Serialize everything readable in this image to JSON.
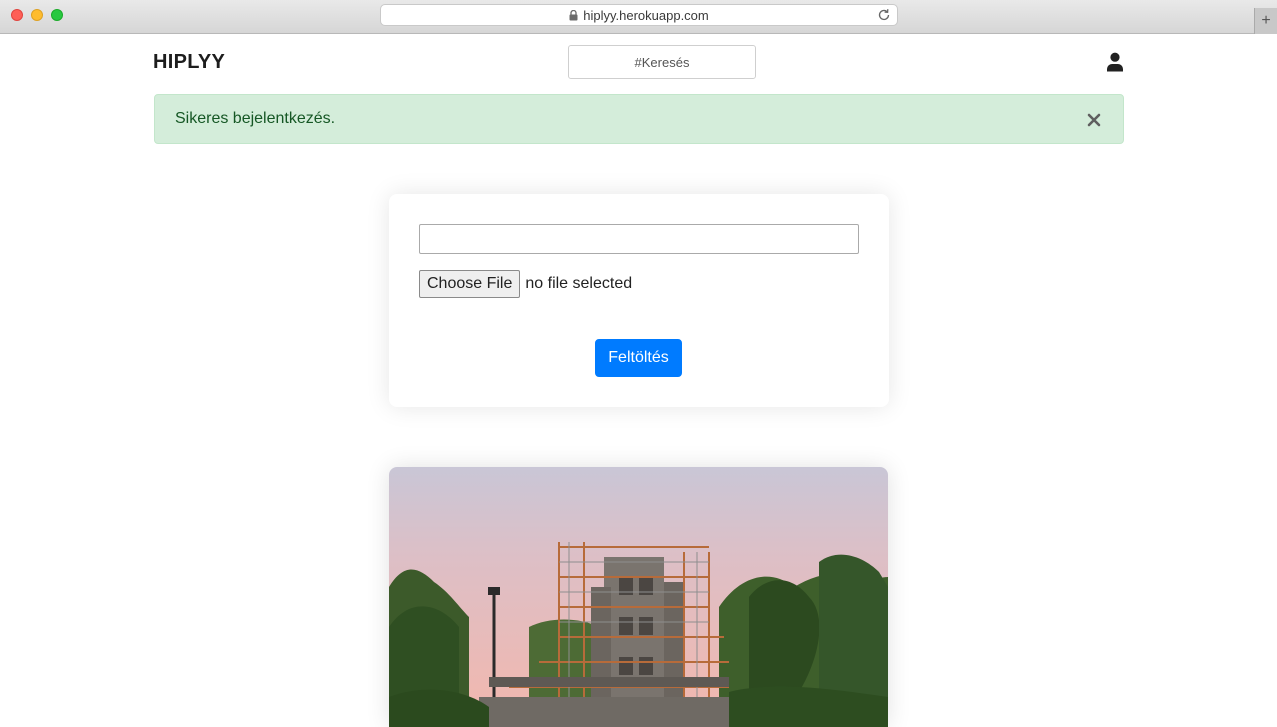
{
  "browser": {
    "url": "hiplyy.herokuapp.com",
    "new_tab_label": "+"
  },
  "header": {
    "brand": "HIPLYY",
    "search_placeholder": "#Keresés",
    "user_icon": "user-icon"
  },
  "alert": {
    "message": "Sikeres bejelentkezés.",
    "close_icon": "close-icon",
    "color": "#155724",
    "background": "#d4edda"
  },
  "upload_form": {
    "text_value": "",
    "file_button_label": "Choose File",
    "file_status": "no file selected",
    "submit_label": "Feltöltés",
    "submit_color": "#007bff"
  },
  "post": {
    "image_subject": "photo-scaffolded-tower"
  }
}
